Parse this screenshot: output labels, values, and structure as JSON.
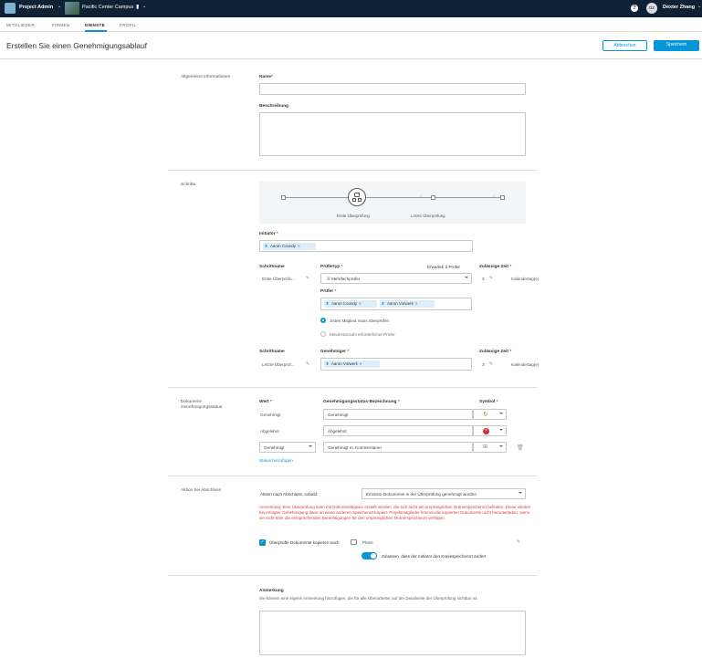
{
  "topbar": {
    "app_name": "Project Admin",
    "project_name": "Pacific Center Campus",
    "help_icon": "question-circle-icon",
    "user_initials": "DZ",
    "user_name": "Dexter Zhang"
  },
  "tabs": [
    {
      "label": "MITGLIEDER"
    },
    {
      "label": "FIRMEN"
    },
    {
      "label": "DIENSTE"
    },
    {
      "label": "PROFIL"
    }
  ],
  "page": {
    "title": "Erstellen Sie einen Genehmigungsablauf",
    "cancel_label": "Abbrechen",
    "save_label": "Speichern"
  },
  "general": {
    "section_label": "Allgemeine Informationen",
    "name_label": "Name",
    "name_value": "",
    "description_label": "Beschreibung",
    "description_value": ""
  },
  "steps": {
    "section_label": "Schritte",
    "flow": {
      "step1": "Erste Überprüfung",
      "step2": "Letzte Überprüfung"
    },
    "initiator_label": "Initiator",
    "initiator_chip": "Aaron Coundy",
    "step1": {
      "name_header": "Schrittname",
      "name_value": "Erste Überprüfu...",
      "type_header": "Prüfertyp",
      "required_text": "Erwartet: 2 Prüfer",
      "type_value": "Mehrfachprüfer",
      "time_header": "Zulässige Zeit",
      "time_value": "3",
      "time_unit": "Kalendertag(e)",
      "reviewer_label": "Prüfer",
      "reviewers": [
        "Aaron Coundy",
        "Aaron Vorwerk"
      ],
      "radio1": "Jedes Mitglied muss überprüfen",
      "radio2": "Mindestanzahl erforderlicher Prüfer"
    },
    "step2": {
      "name_header": "Schrittname",
      "name_value": "Letzte Überprüf...",
      "approver_header": "Genehmiger",
      "approver_chip": "Aaron Vorwerk",
      "time_header": "Zulässige Zeit",
      "time_value": "3",
      "time_unit": "Kalendertag(e)"
    }
  },
  "status": {
    "section_label_1": "Dokument-",
    "section_label_2": "Genehmigungsstatus",
    "value_header": "Wert",
    "label_header": "Genehmigungsstatus-Bezeichnung",
    "symbol_header": "Symbol",
    "rows": [
      {
        "value": "Genehmigt",
        "label": "Genehmigt"
      },
      {
        "value": "Abgelehnt",
        "label": "Abgelehnt"
      },
      {
        "value": "Genehmigt",
        "label": "Genehmigt m. Kommentaren"
      }
    ],
    "add_link": "Status hinzufügen",
    "colors": {
      "approved": "#5aa33c",
      "rejected": "#d0302f",
      "neutral": "#888888"
    }
  },
  "completion": {
    "section_label": "Aktion bei Abschluss",
    "trigger_label": "Aktion nach Abschluss, sobald:",
    "trigger_value": "Einzelne Dokumente in der Überprüfung genehmigt wurden",
    "note_text": "Anmerkung: Eine Überprüfung kann mit Dokumentkopien erstellt werden, die sich nicht am ursprünglichen Ordnerspeicherort befinden. Diese werden bei erfolgter Genehmigung dann an einen anderen Speicherort kopiert. Projektmitglieder können die kopierten Dokumente nicht herunterladen, wenn sie nicht über die entsprechenden Berechtigungen für den ursprünglichen Ordnerspeicherort verfügen.",
    "copy_label": "Überprüfte Dokumente kopieren nach",
    "copy_folder": "Plans",
    "toggle_label": "Zulassen, dass der Initiator den Kopiespeicherort ändert"
  },
  "remark": {
    "title": "Anmerkung",
    "description": "Sie können eine eigene Anmerkung hinzufügen, die für alle Überarbeiter auf der Detailseite der Überprüfung sichtbar ist."
  }
}
